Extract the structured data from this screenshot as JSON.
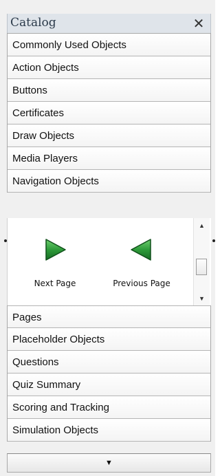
{
  "catalog": {
    "title": "Catalog",
    "close_icon": "✕"
  },
  "categories_top": [
    {
      "label": "Commonly Used Objects"
    },
    {
      "label": "Action Objects"
    },
    {
      "label": "Buttons"
    },
    {
      "label": "Certificates"
    },
    {
      "label": "Draw Objects"
    },
    {
      "label": "Media Players"
    },
    {
      "label": "Navigation Objects"
    }
  ],
  "navigation_objects": [
    {
      "label": "Next Page",
      "icon": "next-page-arrow-icon",
      "color": "#2e7d32"
    },
    {
      "label": "Previous Page",
      "icon": "previous-page-arrow-icon",
      "color": "#2e7d32"
    }
  ],
  "categories_bottom": [
    {
      "label": "Pages"
    },
    {
      "label": "Placeholder Objects"
    },
    {
      "label": "Questions"
    },
    {
      "label": "Quiz Summary"
    },
    {
      "label": "Scoring and Tracking"
    },
    {
      "label": "Simulation Objects"
    }
  ],
  "scrollbar": {
    "up_icon": "▲",
    "down_icon": "▼"
  },
  "expand_bar": {
    "icon": "▼"
  }
}
